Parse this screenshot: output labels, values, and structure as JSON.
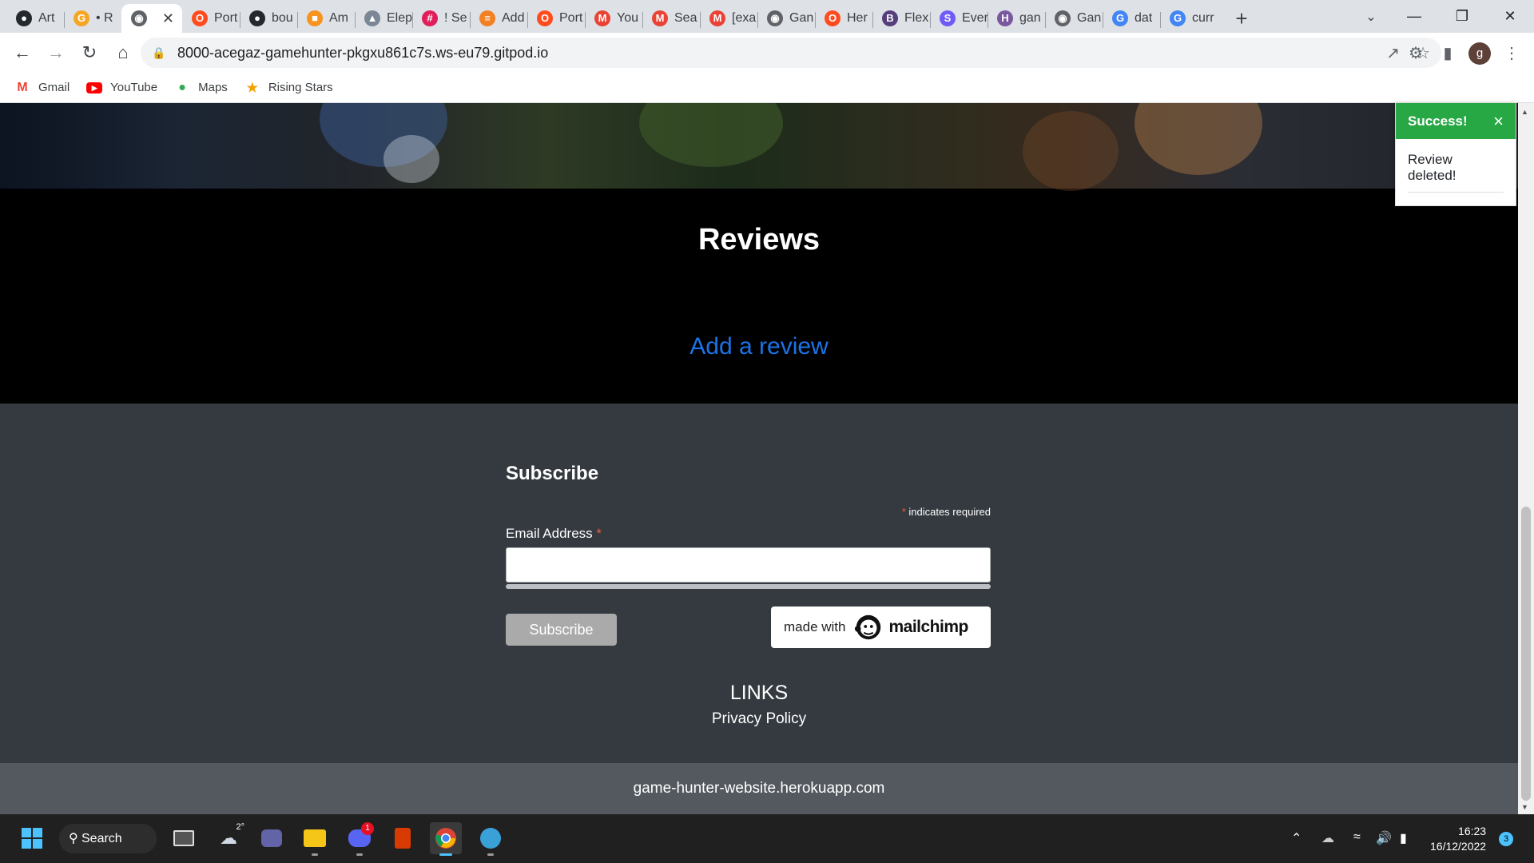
{
  "browser": {
    "tabs": [
      {
        "title": "Art",
        "icon": "github-icon",
        "color": "#24292f"
      },
      {
        "title": "• R",
        "icon": "google-icon",
        "color": "#f5a623"
      },
      {
        "title": "",
        "icon": "globe-icon",
        "color": "#5f6368",
        "active": true
      },
      {
        "title": "Port",
        "icon": "opera-icon",
        "color": "#ff4c1f"
      },
      {
        "title": "bou",
        "icon": "github-icon",
        "color": "#24292f"
      },
      {
        "title": "Am",
        "icon": "box-icon",
        "color": "#f7931e"
      },
      {
        "title": "Elep",
        "icon": "elephant-icon",
        "color": "#7b8794"
      },
      {
        "title": "! Se",
        "icon": "slack-icon",
        "color": "#e01e5a"
      },
      {
        "title": "Add",
        "icon": "stackoverflow-icon",
        "color": "#f48024"
      },
      {
        "title": "Port",
        "icon": "opera-icon",
        "color": "#ff4c1f"
      },
      {
        "title": "You",
        "icon": "gmail-icon",
        "color": "#ea4335"
      },
      {
        "title": "Sea",
        "icon": "gmail-icon",
        "color": "#ea4335"
      },
      {
        "title": "[exa",
        "icon": "gmail-icon",
        "color": "#ea4335"
      },
      {
        "title": "Gan",
        "icon": "globe-icon",
        "color": "#5f6368"
      },
      {
        "title": "Her",
        "icon": "opera-icon",
        "color": "#ff4c1f"
      },
      {
        "title": "Flex",
        "icon": "bootstrap-icon",
        "color": "#563d7c"
      },
      {
        "title": "Ever",
        "icon": "s-icon",
        "color": "#6f5cf7"
      },
      {
        "title": "gan",
        "icon": "heroku-icon",
        "color": "#79589f"
      },
      {
        "title": "Gan",
        "icon": "globe-icon",
        "color": "#5f6368"
      },
      {
        "title": "dat",
        "icon": "google-g-icon",
        "color": "#4285f4"
      },
      {
        "title": "curr",
        "icon": "google-g-icon",
        "color": "#4285f4"
      }
    ],
    "url": "8000-acegaz-gamehunter-pkgxu861c7s.ws-eu79.gitpod.io",
    "profile_initial": "g",
    "bookmarks": [
      {
        "label": "Gmail",
        "icon": "gmail-icon",
        "color": "#ea4335"
      },
      {
        "label": "YouTube",
        "icon": "youtube-icon",
        "color": "#ff0000"
      },
      {
        "label": "Maps",
        "icon": "maps-pin-icon",
        "color": "#34a853"
      },
      {
        "label": "Rising Stars",
        "icon": "star-icon",
        "color": "#f4a100"
      }
    ]
  },
  "page": {
    "reviews_title": "Reviews",
    "add_review_link": "Add a review",
    "subscribe": {
      "title": "Subscribe",
      "required_star": "*",
      "required_note": "indicates required",
      "email_label": "Email Address",
      "email_value": "",
      "button_label": "Subscribe",
      "made_with": "made with",
      "brand": "mailchimp"
    },
    "links_heading": "LINKS",
    "privacy_link": "Privacy Policy",
    "footer_domain": "game-hunter-website.herokuapp.com"
  },
  "toast": {
    "title": "Success!",
    "message": "Review deleted!",
    "color": "#28a745"
  },
  "taskbar": {
    "search_label": "Search",
    "weather_temp": "2°",
    "discord_badge": "1",
    "time": "16:23",
    "date": "16/12/2022",
    "notification_count": "3"
  }
}
